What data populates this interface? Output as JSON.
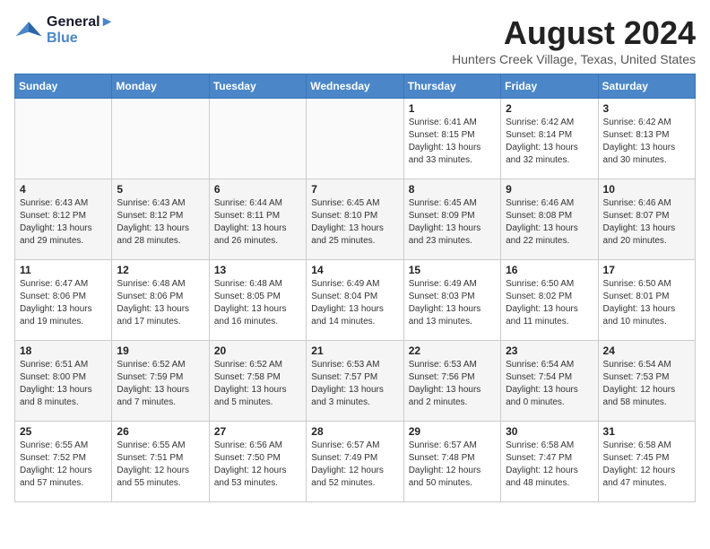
{
  "logo": {
    "line1": "General",
    "line2": "Blue"
  },
  "title": "August 2024",
  "location": "Hunters Creek Village, Texas, United States",
  "weekdays": [
    "Sunday",
    "Monday",
    "Tuesday",
    "Wednesday",
    "Thursday",
    "Friday",
    "Saturday"
  ],
  "weeks": [
    [
      {
        "day": "",
        "info": ""
      },
      {
        "day": "",
        "info": ""
      },
      {
        "day": "",
        "info": ""
      },
      {
        "day": "",
        "info": ""
      },
      {
        "day": "1",
        "info": "Sunrise: 6:41 AM\nSunset: 8:15 PM\nDaylight: 13 hours\nand 33 minutes."
      },
      {
        "day": "2",
        "info": "Sunrise: 6:42 AM\nSunset: 8:14 PM\nDaylight: 13 hours\nand 32 minutes."
      },
      {
        "day": "3",
        "info": "Sunrise: 6:42 AM\nSunset: 8:13 PM\nDaylight: 13 hours\nand 30 minutes."
      }
    ],
    [
      {
        "day": "4",
        "info": "Sunrise: 6:43 AM\nSunset: 8:12 PM\nDaylight: 13 hours\nand 29 minutes."
      },
      {
        "day": "5",
        "info": "Sunrise: 6:43 AM\nSunset: 8:12 PM\nDaylight: 13 hours\nand 28 minutes."
      },
      {
        "day": "6",
        "info": "Sunrise: 6:44 AM\nSunset: 8:11 PM\nDaylight: 13 hours\nand 26 minutes."
      },
      {
        "day": "7",
        "info": "Sunrise: 6:45 AM\nSunset: 8:10 PM\nDaylight: 13 hours\nand 25 minutes."
      },
      {
        "day": "8",
        "info": "Sunrise: 6:45 AM\nSunset: 8:09 PM\nDaylight: 13 hours\nand 23 minutes."
      },
      {
        "day": "9",
        "info": "Sunrise: 6:46 AM\nSunset: 8:08 PM\nDaylight: 13 hours\nand 22 minutes."
      },
      {
        "day": "10",
        "info": "Sunrise: 6:46 AM\nSunset: 8:07 PM\nDaylight: 13 hours\nand 20 minutes."
      }
    ],
    [
      {
        "day": "11",
        "info": "Sunrise: 6:47 AM\nSunset: 8:06 PM\nDaylight: 13 hours\nand 19 minutes."
      },
      {
        "day": "12",
        "info": "Sunrise: 6:48 AM\nSunset: 8:06 PM\nDaylight: 13 hours\nand 17 minutes."
      },
      {
        "day": "13",
        "info": "Sunrise: 6:48 AM\nSunset: 8:05 PM\nDaylight: 13 hours\nand 16 minutes."
      },
      {
        "day": "14",
        "info": "Sunrise: 6:49 AM\nSunset: 8:04 PM\nDaylight: 13 hours\nand 14 minutes."
      },
      {
        "day": "15",
        "info": "Sunrise: 6:49 AM\nSunset: 8:03 PM\nDaylight: 13 hours\nand 13 minutes."
      },
      {
        "day": "16",
        "info": "Sunrise: 6:50 AM\nSunset: 8:02 PM\nDaylight: 13 hours\nand 11 minutes."
      },
      {
        "day": "17",
        "info": "Sunrise: 6:50 AM\nSunset: 8:01 PM\nDaylight: 13 hours\nand 10 minutes."
      }
    ],
    [
      {
        "day": "18",
        "info": "Sunrise: 6:51 AM\nSunset: 8:00 PM\nDaylight: 13 hours\nand 8 minutes."
      },
      {
        "day": "19",
        "info": "Sunrise: 6:52 AM\nSunset: 7:59 PM\nDaylight: 13 hours\nand 7 minutes."
      },
      {
        "day": "20",
        "info": "Sunrise: 6:52 AM\nSunset: 7:58 PM\nDaylight: 13 hours\nand 5 minutes."
      },
      {
        "day": "21",
        "info": "Sunrise: 6:53 AM\nSunset: 7:57 PM\nDaylight: 13 hours\nand 3 minutes."
      },
      {
        "day": "22",
        "info": "Sunrise: 6:53 AM\nSunset: 7:56 PM\nDaylight: 13 hours\nand 2 minutes."
      },
      {
        "day": "23",
        "info": "Sunrise: 6:54 AM\nSunset: 7:54 PM\nDaylight: 13 hours\nand 0 minutes."
      },
      {
        "day": "24",
        "info": "Sunrise: 6:54 AM\nSunset: 7:53 PM\nDaylight: 12 hours\nand 58 minutes."
      }
    ],
    [
      {
        "day": "25",
        "info": "Sunrise: 6:55 AM\nSunset: 7:52 PM\nDaylight: 12 hours\nand 57 minutes."
      },
      {
        "day": "26",
        "info": "Sunrise: 6:55 AM\nSunset: 7:51 PM\nDaylight: 12 hours\nand 55 minutes."
      },
      {
        "day": "27",
        "info": "Sunrise: 6:56 AM\nSunset: 7:50 PM\nDaylight: 12 hours\nand 53 minutes."
      },
      {
        "day": "28",
        "info": "Sunrise: 6:57 AM\nSunset: 7:49 PM\nDaylight: 12 hours\nand 52 minutes."
      },
      {
        "day": "29",
        "info": "Sunrise: 6:57 AM\nSunset: 7:48 PM\nDaylight: 12 hours\nand 50 minutes."
      },
      {
        "day": "30",
        "info": "Sunrise: 6:58 AM\nSunset: 7:47 PM\nDaylight: 12 hours\nand 48 minutes."
      },
      {
        "day": "31",
        "info": "Sunrise: 6:58 AM\nSunset: 7:45 PM\nDaylight: 12 hours\nand 47 minutes."
      }
    ]
  ]
}
